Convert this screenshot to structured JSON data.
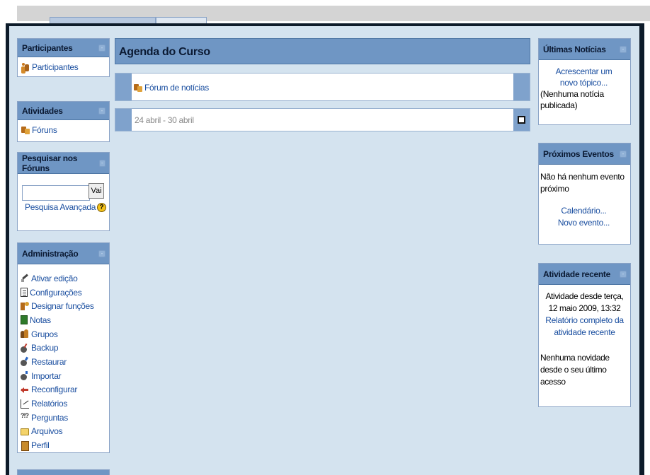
{
  "left": {
    "participantes": {
      "title": "Participantes",
      "items": [
        {
          "label": "Participantes",
          "icon": "people-icon"
        }
      ]
    },
    "atividades": {
      "title": "Atividades",
      "items": [
        {
          "label": "Fóruns",
          "icon": "forum-icon"
        }
      ]
    },
    "search": {
      "title": "Pesquisar nos Fóruns",
      "input_value": "",
      "button_label": "Vai",
      "advanced_label": "Pesquisa Avançada",
      "help_symbol": "?"
    },
    "admin": {
      "title": "Administração",
      "items": [
        {
          "label": "Ativar edição",
          "icon": "edit-icon"
        },
        {
          "label": "Configurações",
          "icon": "settings-icon"
        },
        {
          "label": "Designar funções",
          "icon": "roles-icon"
        },
        {
          "label": "Notas",
          "icon": "grades-icon"
        },
        {
          "label": "Grupos",
          "icon": "groups-icon"
        },
        {
          "label": "Backup",
          "icon": "backup-icon"
        },
        {
          "label": "Restaurar",
          "icon": "restore-icon"
        },
        {
          "label": "Importar",
          "icon": "import-icon"
        },
        {
          "label": "Reconfigurar",
          "icon": "reset-icon"
        },
        {
          "label": "Relatórios",
          "icon": "reports-icon"
        },
        {
          "label": "Perguntas",
          "icon": "questions-icon"
        },
        {
          "label": "Arquivos",
          "icon": "files-icon"
        },
        {
          "label": "Perfil",
          "icon": "profile-icon"
        }
      ]
    }
  },
  "center": {
    "title": "Agenda do Curso",
    "sections": [
      {
        "label": "Fórum de notícias",
        "icon": "forum-icon"
      },
      {
        "label": "24 abril - 30 abril"
      }
    ]
  },
  "right": {
    "news": {
      "title": "Últimas Notícias",
      "add_link": "Acrescentar um novo tópico...",
      "empty": "(Nenhuma notícia publicada)"
    },
    "events": {
      "title": "Próximos Eventos",
      "empty": "Não há nenhum evento próximo",
      "calendar_link": "Calendário...",
      "new_event_link": "Novo evento..."
    },
    "recent": {
      "title": "Atividade recente",
      "since": "Atividade desde terça, 12 maio 2009, 13:32",
      "full_report_link": "Relatório completo da atividade recente",
      "no_news": "Nenhuma novidade desde o seu último acesso"
    }
  },
  "hide_symbol": "-",
  "colors": {
    "block_header": "#6f96c4",
    "background": "#d4e3ef",
    "link": "#1b4fa0",
    "frame": "#0d1b2a"
  }
}
